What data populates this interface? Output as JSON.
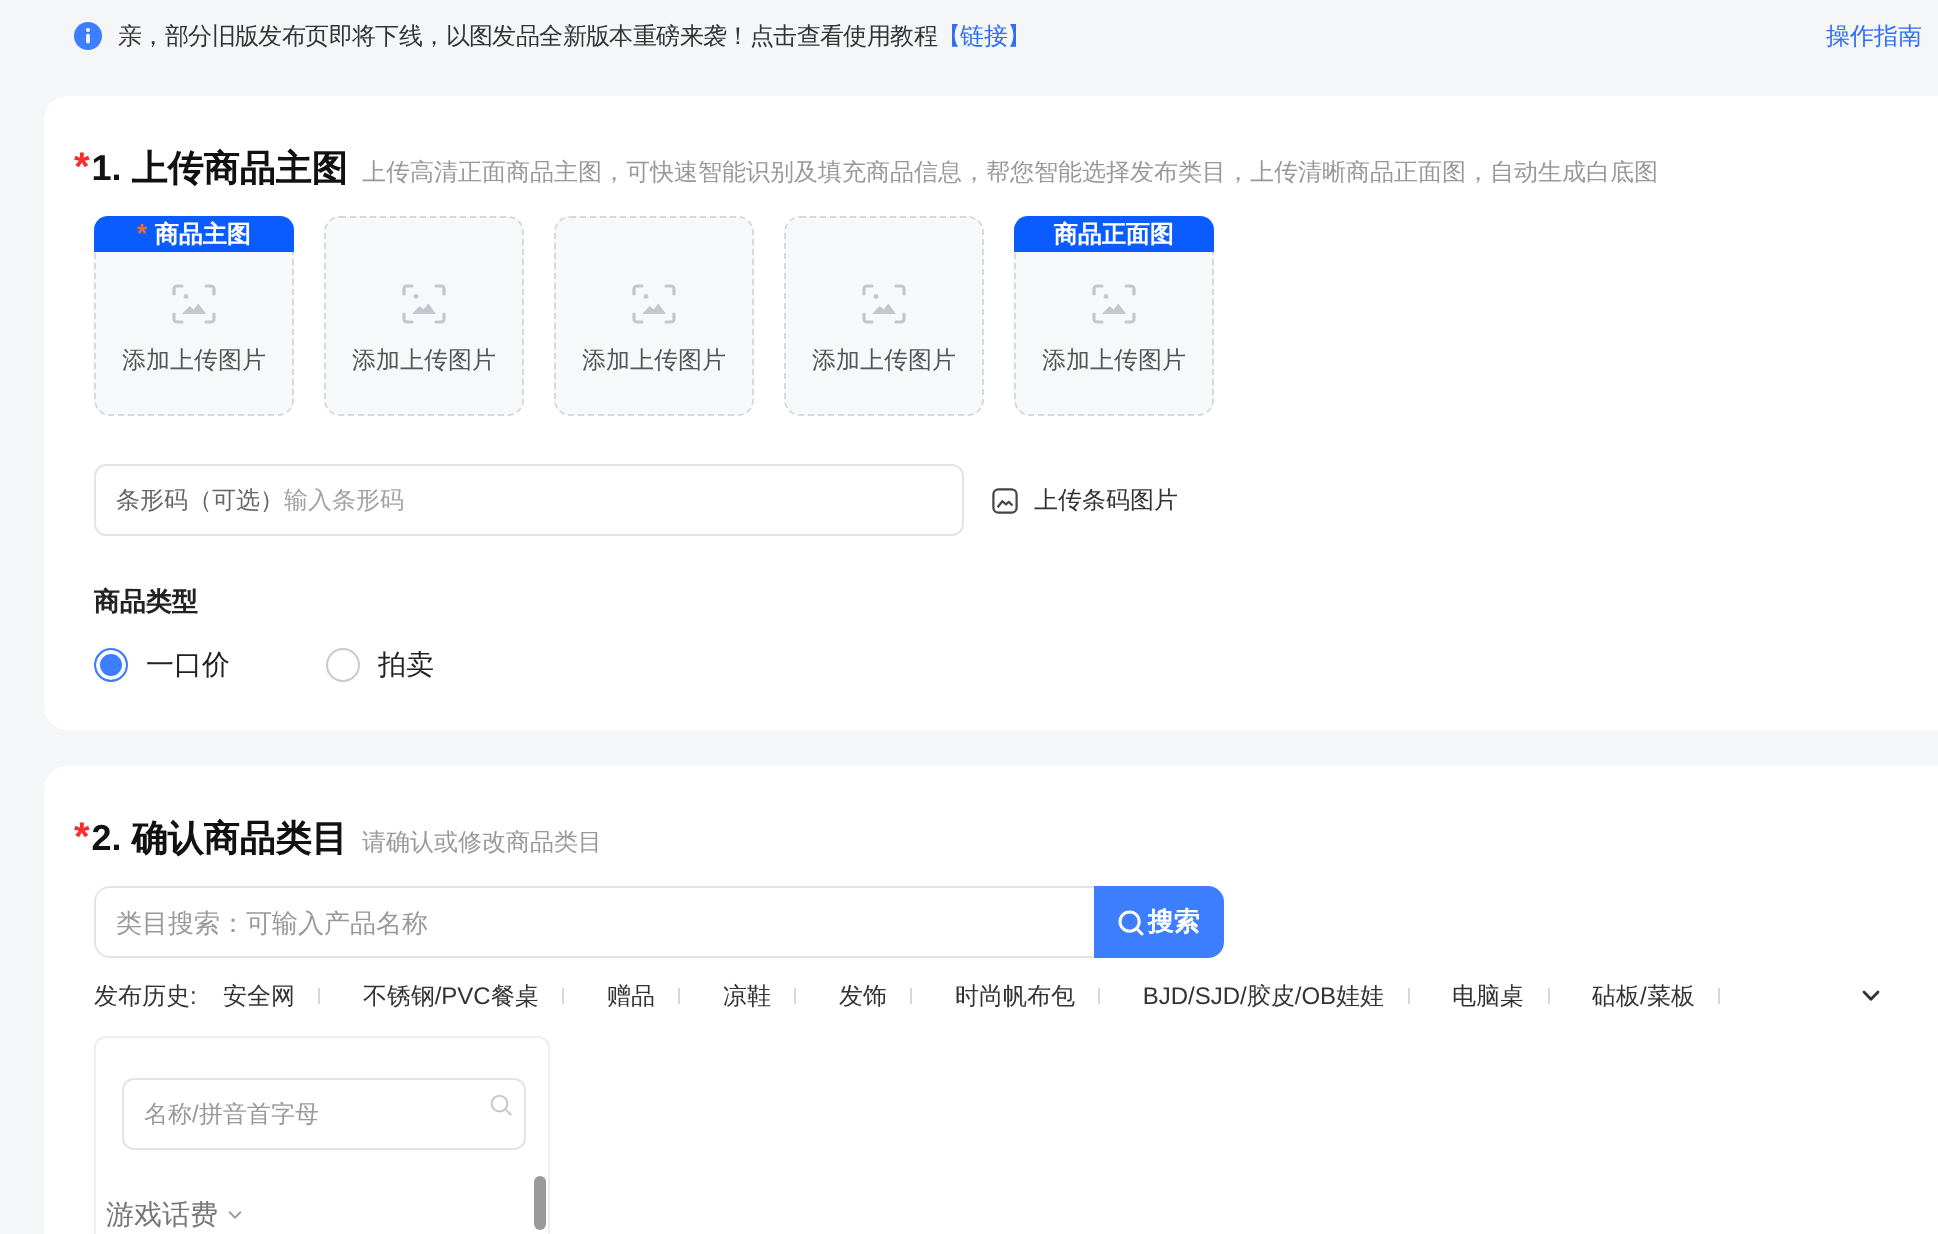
{
  "notice": {
    "text": "亲，部分旧版发布页即将下线，以图发品全新版本重磅来袭！点击查看使用教程",
    "link": "【链接】",
    "guide": "操作指南"
  },
  "upload_section": {
    "required_mark": "*",
    "title": "1. 上传商品主图",
    "subtitle": "上传高清正面商品主图，可快速智能识别及填充商品信息，帮您智能选择发布类目，上传清晰商品正面图，自动生成白底图",
    "slots": [
      {
        "tag": "商品主图",
        "tag_mark": "*",
        "label": "添加上传图片"
      },
      {
        "label": "添加上传图片"
      },
      {
        "label": "添加上传图片"
      },
      {
        "label": "添加上传图片"
      },
      {
        "tag": "商品正面图",
        "label": "添加上传图片"
      }
    ],
    "barcode": {
      "label": "条形码（可选）",
      "placeholder": "输入条形码",
      "upload_button": "上传条码图片"
    },
    "product_type": {
      "label": "商品类型",
      "options": [
        {
          "label": "一口价",
          "selected": true
        },
        {
          "label": "拍卖",
          "selected": false
        }
      ]
    }
  },
  "category_section": {
    "required_mark": "*",
    "title": "2. 确认商品类目",
    "subtitle": "请确认或修改商品类目",
    "search": {
      "placeholder": "类目搜索：可输入产品名称",
      "button": "搜索"
    },
    "history": {
      "label": "发布历史:",
      "items": [
        "安全网",
        "不锈钢/PVC餐桌",
        "赠品",
        "凉鞋",
        "发饰",
        "时尚帆布包",
        "BJD/SJD/胶皮/OB娃娃",
        "电脑桌",
        "砧板/菜板"
      ]
    },
    "panel": {
      "search_placeholder": "名称/拼音首字母",
      "categories": [
        {
          "label": "游戏话费"
        }
      ]
    }
  }
}
